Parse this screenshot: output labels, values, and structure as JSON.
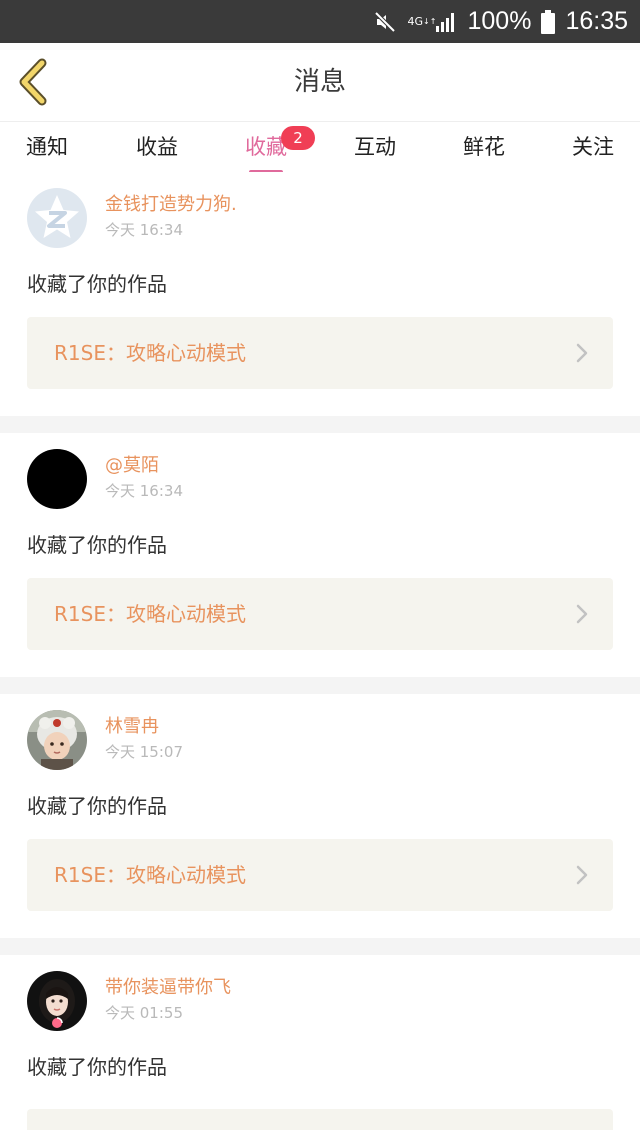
{
  "status_bar": {
    "network": "4G",
    "network_sub": "↓↑",
    "battery": "100%",
    "time": "16:35"
  },
  "header": {
    "title": "消息",
    "back_icon": "chevron-left-icon"
  },
  "tabs": [
    {
      "label": "通知"
    },
    {
      "label": "收益"
    },
    {
      "label": "收藏",
      "badge": "2",
      "active": true
    },
    {
      "label": "互动"
    },
    {
      "label": "鲜花"
    },
    {
      "label": "关注"
    }
  ],
  "feed": [
    {
      "user": "金钱打造势力狗.",
      "time": "今天 16:34",
      "action": "收藏了你的作品",
      "work": "R1SE：攻略心动模式",
      "avatar": "qq-default-avatar"
    },
    {
      "user": "@莫陌",
      "time": "今天 16:34",
      "action": "收藏了你的作品",
      "work": "R1SE：攻略心动模式",
      "avatar": "black-avatar"
    },
    {
      "user": "林雪冉",
      "time": "今天 15:07",
      "action": "收藏了你的作品",
      "work": "R1SE：攻略心动模式",
      "avatar": "child-photo-avatar"
    },
    {
      "user": "带你装逼带你飞",
      "time": "今天 01:55",
      "action": "收藏了你的作品",
      "avatar": "girl-photo-avatar"
    }
  ],
  "colors": {
    "accent": "#e06a9c",
    "username": "#e8935e",
    "badge": "#f03e55",
    "work_bg": "#f5f4ee"
  }
}
